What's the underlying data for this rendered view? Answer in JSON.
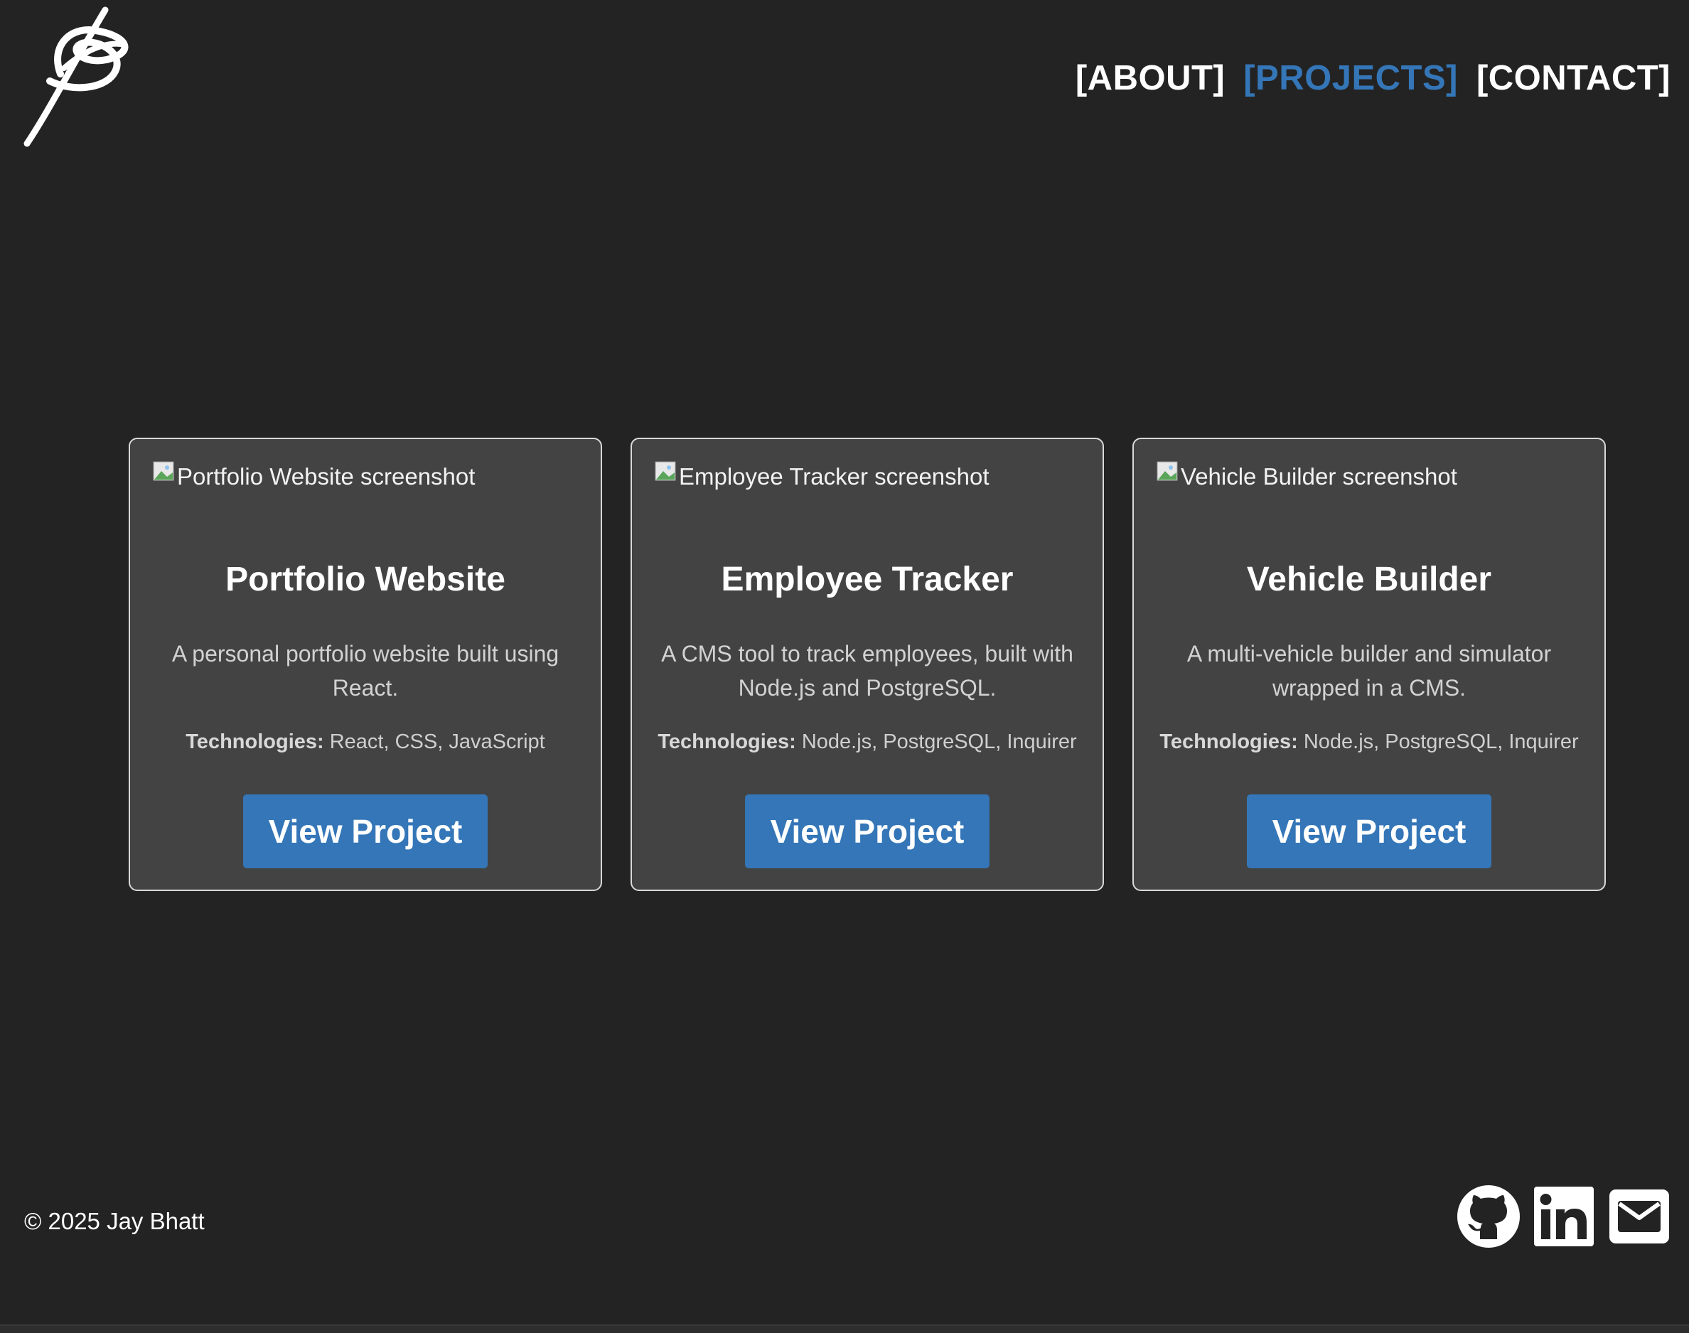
{
  "header": {
    "logo_icon": "signature-logo",
    "nav": [
      {
        "label": "[ABOUT]",
        "active": false
      },
      {
        "label": "[PROJECTS]",
        "active": true
      },
      {
        "label": "[CONTACT]",
        "active": false
      }
    ]
  },
  "colors": {
    "background": "#232323",
    "card_background": "#434343",
    "accent": "#3476b7",
    "text": "#ffffff"
  },
  "projects": [
    {
      "image_alt": "Portfolio Website screenshot",
      "title": "Portfolio Website",
      "description": "A personal portfolio website built using React.",
      "technologies_label": "Technologies:",
      "technologies": "React, CSS, JavaScript",
      "button_label": "View Project"
    },
    {
      "image_alt": "Employee Tracker screenshot",
      "title": "Employee Tracker",
      "description": "A CMS tool to track employees, built with Node.js and PostgreSQL.",
      "technologies_label": "Technologies:",
      "technologies": "Node.js, PostgreSQL, Inquirer",
      "button_label": "View Project"
    },
    {
      "image_alt": "Vehicle Builder screenshot",
      "title": "Vehicle Builder",
      "description": "A multi-vehicle builder and simulator wrapped in a CMS.",
      "technologies_label": "Technologies:",
      "technologies": "Node.js, PostgreSQL, Inquirer",
      "button_label": "View Project"
    }
  ],
  "footer": {
    "copyright": "© 2025 Jay Bhatt",
    "socials": [
      "github-icon",
      "linkedin-icon",
      "email-icon"
    ]
  }
}
